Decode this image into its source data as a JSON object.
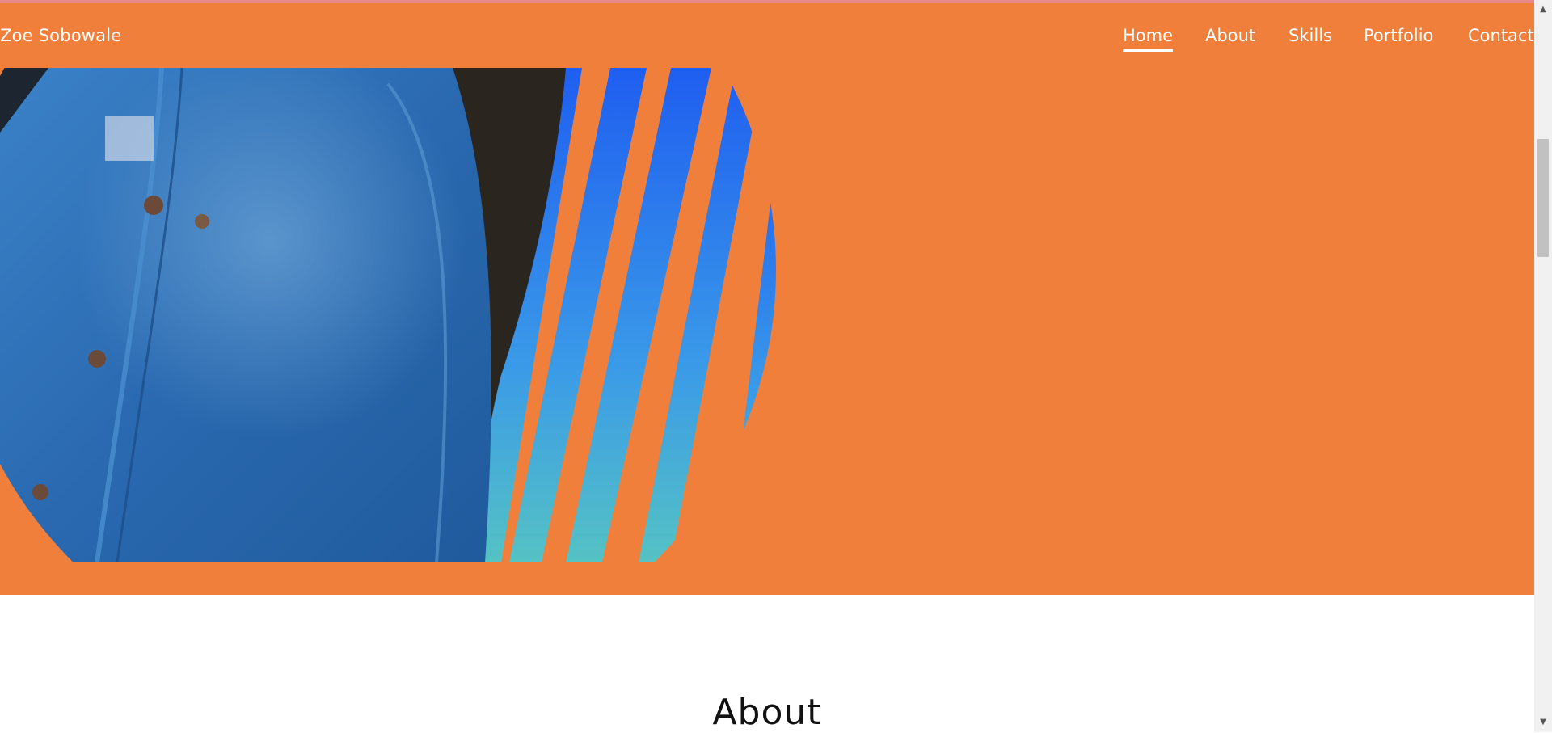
{
  "brand": {
    "name": "Zoe Sobowale"
  },
  "nav": {
    "items": [
      {
        "label": "Home",
        "active": true
      },
      {
        "label": "About",
        "active": false
      },
      {
        "label": "Skills",
        "active": false
      },
      {
        "label": "Portfolio",
        "active": false
      },
      {
        "label": "Contact",
        "active": false
      }
    ]
  },
  "about": {
    "heading": "About"
  },
  "colors": {
    "accent": "#f07f3c",
    "stripe_blue": "#2f78f5",
    "stripe_teal": "#4fc0c8",
    "denim": "#2a69b0"
  },
  "icons": {
    "scroll_up": "triangle-up-icon",
    "scroll_down": "triangle-down-icon"
  }
}
